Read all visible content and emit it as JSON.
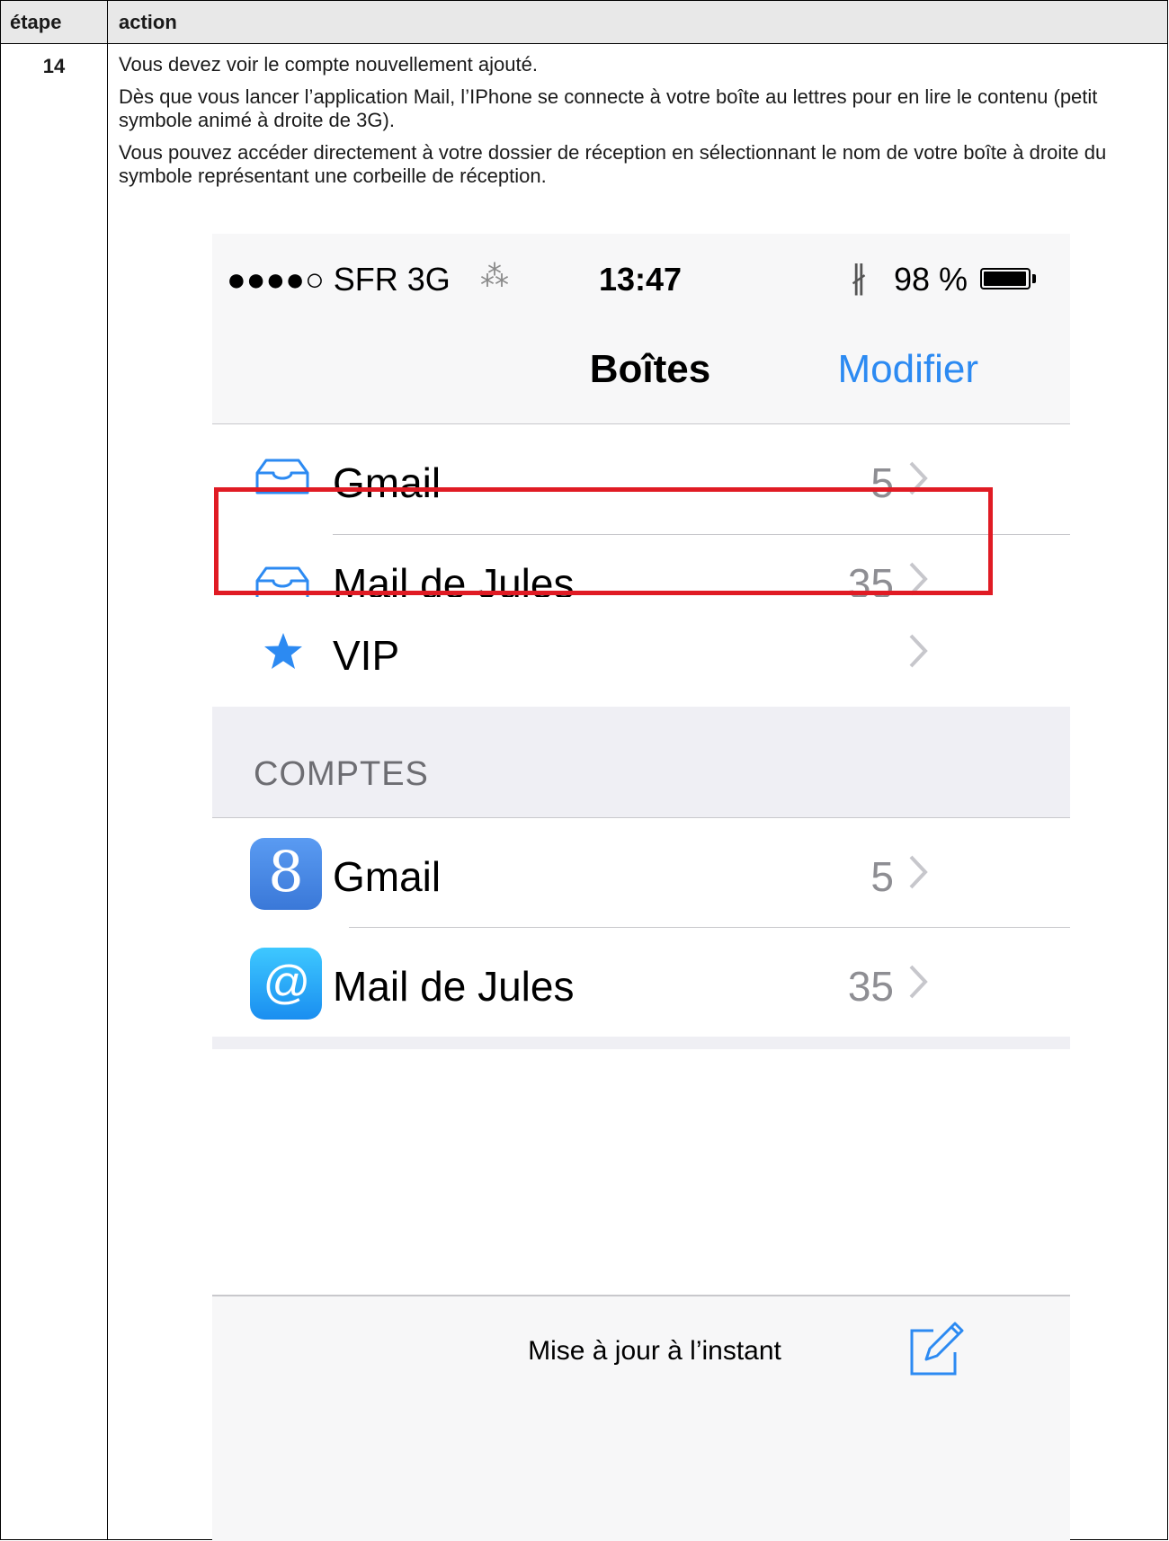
{
  "table": {
    "header_step": "étape",
    "header_action": "action",
    "step_number": "14",
    "paragraphs": [
      "Vous devez voir le compte nouvellement ajouté.",
      "Dès que vous lancer l’application Mail, l’IPhone se connecte à votre boîte au lettres pour en lire le contenu (petit symbole animé à droite de 3G).",
      "Vous pouvez accéder directement à votre dossier de réception en sélectionnant le nom de votre boîte à droite du symbole représentant une corbeille de réception."
    ]
  },
  "phone": {
    "status_bar": {
      "signal_and_carrier": "●●●●○ SFR  3G",
      "activity_spinner": "⁂",
      "time": "13:47",
      "bluetooth": "∦",
      "battery_percent": "98 %",
      "battery_level": 0.98
    },
    "navbar": {
      "title": "Boîtes",
      "edit_label": "Modifier"
    },
    "mailboxes": [
      {
        "label": "Gmail",
        "count": "5",
        "icon": "inbox-tray-icon"
      },
      {
        "label": "Mail de Jules",
        "count": "35",
        "icon": "inbox-tray-icon",
        "highlighted": true
      },
      {
        "label": "VIP",
        "count": "",
        "icon": "star-icon"
      }
    ],
    "accounts_section": "COMPTES",
    "accounts": [
      {
        "label": "Gmail",
        "count": "5",
        "icon_glyph": "8",
        "icon": "gmail-app-icon"
      },
      {
        "label": "Mail de Jules",
        "count": "35",
        "icon_glyph": "@",
        "icon": "at-mail-icon"
      }
    ],
    "toolbar": {
      "update_status": "Mise à jour à l’instant",
      "compose_icon": "compose-icon"
    },
    "colors": {
      "accent_blue": "#2c8af2",
      "highlight_red": "#e01b24"
    }
  }
}
